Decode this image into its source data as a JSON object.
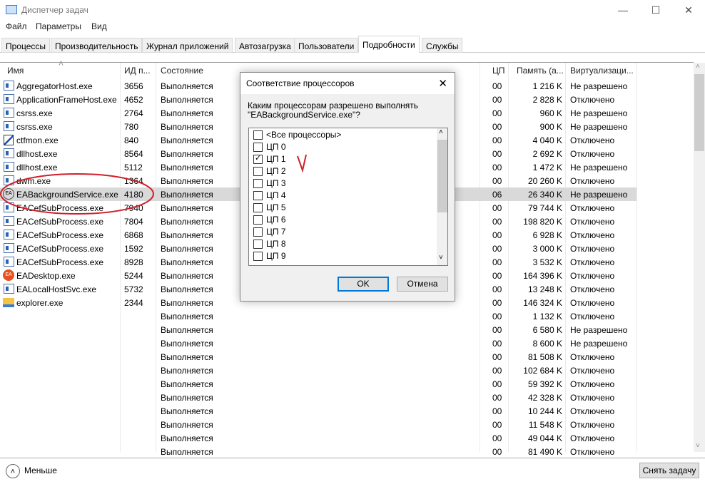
{
  "window": {
    "title": "Диспетчер задач",
    "minimize": "—",
    "maximize": "☐",
    "close": "✕"
  },
  "menu": [
    "Файл",
    "Параметры",
    "Вид"
  ],
  "tabs": [
    "Процессы",
    "Производительность",
    "Журнал приложений",
    "Автозагрузка",
    "Пользователи",
    "Подробности",
    "Службы"
  ],
  "columns": {
    "name": "Имя",
    "pid": "ИД п...",
    "state": "Состояние",
    "cpu": "ЦП",
    "memory": "Память (а...",
    "virt": "Виртуализаци..."
  },
  "rows": [
    {
      "name": "AggregatorHost.exe",
      "pid": "3656",
      "state": "Выполняется",
      "cpu": "00",
      "mem": "1 216 K",
      "virt": "Не разрешено"
    },
    {
      "name": "ApplicationFrameHost.exe",
      "pid": "4652",
      "state": "Выполняется",
      "cpu": "00",
      "mem": "2 828 K",
      "virt": "Отключено"
    },
    {
      "name": "csrss.exe",
      "pid": "2764",
      "state": "Выполняется",
      "cpu": "00",
      "mem": "960 K",
      "virt": "Не разрешено"
    },
    {
      "name": "csrss.exe",
      "pid": "780",
      "state": "Выполняется",
      "cpu": "00",
      "mem": "900 K",
      "virt": "Не разрешено"
    },
    {
      "name": "ctfmon.exe",
      "pid": "840",
      "state": "Выполняется",
      "cpu": "00",
      "mem": "4 040 K",
      "virt": "Отключено"
    },
    {
      "name": "dllhost.exe",
      "pid": "8564",
      "state": "Выполняется",
      "cpu": "00",
      "mem": "2 692 K",
      "virt": "Отключено"
    },
    {
      "name": "dllhost.exe",
      "pid": "5112",
      "state": "Выполняется",
      "cpu": "00",
      "mem": "1 472 K",
      "virt": "Не разрешено"
    },
    {
      "name": "dwm.exe",
      "pid": "1364",
      "state": "Выполняется",
      "cpu": "00",
      "mem": "20 260 K",
      "virt": "Отключено"
    },
    {
      "name": "EABackgroundService.exe",
      "pid": "4180",
      "state": "Выполняется",
      "cpu": "06",
      "mem": "26 340 K",
      "virt": "Не разрешено"
    },
    {
      "name": "EACefSubProcess.exe",
      "pid": "7940",
      "state": "Выполняется",
      "cpu": "00",
      "mem": "79 744 K",
      "virt": "Отключено"
    },
    {
      "name": "EACefSubProcess.exe",
      "pid": "7804",
      "state": "Выполняется",
      "cpu": "00",
      "mem": "198 820 K",
      "virt": "Отключено"
    },
    {
      "name": "EACefSubProcess.exe",
      "pid": "6868",
      "state": "Выполняется",
      "cpu": "00",
      "mem": "6 928 K",
      "virt": "Отключено"
    },
    {
      "name": "EACefSubProcess.exe",
      "pid": "1592",
      "state": "Выполняется",
      "cpu": "00",
      "mem": "3 000 K",
      "virt": "Отключено"
    },
    {
      "name": "EACefSubProcess.exe",
      "pid": "8928",
      "state": "Выполняется",
      "cpu": "00",
      "mem": "3 532 K",
      "virt": "Отключено"
    },
    {
      "name": "EADesktop.exe",
      "pid": "5244",
      "state": "Выполняется",
      "cpu": "00",
      "mem": "164 396 K",
      "virt": "Отключено"
    },
    {
      "name": "EALocalHostSvc.exe",
      "pid": "5732",
      "state": "Выполняется",
      "cpu": "00",
      "mem": "13 248 K",
      "virt": "Отключено"
    },
    {
      "name": "explorer.exe",
      "pid": "2344",
      "state": "Выполняется",
      "cpu": "00",
      "mem": "146 324 K",
      "virt": "Отключено"
    },
    {
      "name": "",
      "pid": "",
      "state": "Выполняется",
      "cpu": "00",
      "mem": "1 132 K",
      "virt": "Отключено"
    },
    {
      "name": "",
      "pid": "",
      "state": "Выполняется",
      "cpu": "00",
      "mem": "6 580 K",
      "virt": "Не разрешено"
    },
    {
      "name": "",
      "pid": "",
      "state": "Выполняется",
      "cpu": "00",
      "mem": "8 600 K",
      "virt": "Не разрешено"
    },
    {
      "name": "",
      "pid": "",
      "state": "Выполняется",
      "cpu": "00",
      "mem": "81 508 K",
      "virt": "Отключено"
    },
    {
      "name": "",
      "pid": "",
      "state": "Выполняется",
      "cpu": "00",
      "mem": "102 684 K",
      "virt": "Отключено"
    },
    {
      "name": "",
      "pid": "",
      "state": "Выполняется",
      "cpu": "00",
      "mem": "59 392 K",
      "virt": "Отключено"
    },
    {
      "name": "",
      "pid": "",
      "state": "Выполняется",
      "cpu": "00",
      "mem": "42 328 K",
      "virt": "Отключено"
    },
    {
      "name": "",
      "pid": "",
      "state": "Выполняется",
      "cpu": "00",
      "mem": "10 244 K",
      "virt": "Отключено"
    },
    {
      "name": "",
      "pid": "",
      "state": "Выполняется",
      "cpu": "00",
      "mem": "11 548 K",
      "virt": "Отключено"
    },
    {
      "name": "",
      "pid": "",
      "state": "Выполняется",
      "cpu": "00",
      "mem": "49 044 K",
      "virt": "Отключено"
    },
    {
      "name": "",
      "pid": "",
      "state": "Выполняется",
      "cpu": "00",
      "mem": "81 490 K",
      "virt": "Отключено"
    }
  ],
  "selected_row": 8,
  "dialog": {
    "title": "Соответствие процессоров",
    "question": "Каким процессорам разрешено выполнять",
    "process": "\"EABackgroundService.exe\"?",
    "items": [
      {
        "label": "<Все процессоры>",
        "checked": false
      },
      {
        "label": "ЦП 0",
        "checked": false
      },
      {
        "label": "ЦП 1",
        "checked": true
      },
      {
        "label": "ЦП 2",
        "checked": false
      },
      {
        "label": "ЦП 3",
        "checked": false
      },
      {
        "label": "ЦП 4",
        "checked": false
      },
      {
        "label": "ЦП 5",
        "checked": false
      },
      {
        "label": "ЦП 6",
        "checked": false
      },
      {
        "label": "ЦП 7",
        "checked": false
      },
      {
        "label": "ЦП 8",
        "checked": false
      },
      {
        "label": "ЦП 9",
        "checked": false
      }
    ],
    "ok": "OK",
    "cancel": "Отмена",
    "close": "✕"
  },
  "footer": {
    "less": "Меньше",
    "end_task": "Снять задачу"
  },
  "annotation_color": "#d0202a"
}
